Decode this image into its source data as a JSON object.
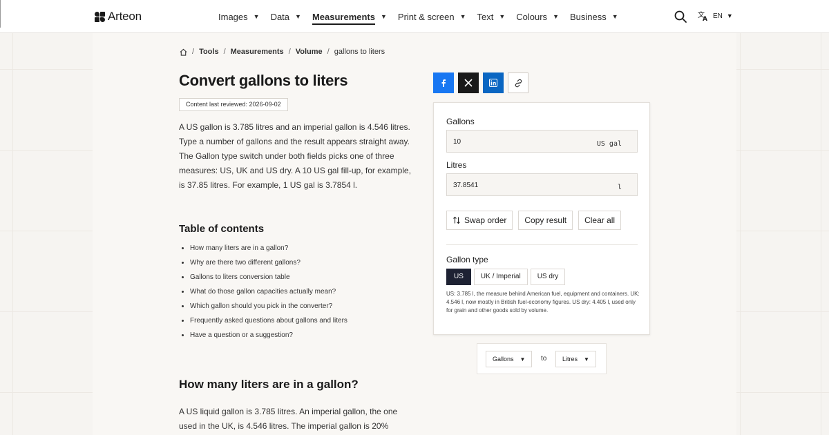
{
  "header": {
    "brand": "Arteon",
    "nav": [
      {
        "label": "Images",
        "active": false
      },
      {
        "label": "Data",
        "active": false
      },
      {
        "label": "Measurements",
        "active": true
      },
      {
        "label": "Print & screen",
        "active": false
      },
      {
        "label": "Text",
        "active": false
      },
      {
        "label": "Colours",
        "active": false
      },
      {
        "label": "Business",
        "active": false
      }
    ],
    "lang": "EN",
    "icons": {
      "search": "search-icon",
      "translate": "translate-icon",
      "caret": "chevron-down-icon"
    }
  },
  "breadcrumb": {
    "items": [
      "Tools",
      "Measurements",
      "Volume"
    ],
    "current": "gallons to liters"
  },
  "article": {
    "title": "Convert gallons to liters",
    "reviewed": "Content last reviewed: 2026-09-02",
    "intro": "A US gallon is 3.785 litres and an imperial gallon is 4.546 litres. Type a number of gallons and the result appears straight away. The Gallon type switch under both fields picks one of three measures: US, UK and US dry. A 10 US gal fill-up, for example, is 37.85 litres. For example, 1 US gal is 3.7854 l.",
    "toc_title": "Table of contents",
    "toc": [
      "How many liters are in a gallon?",
      "Why are there two different gallons?",
      "Gallons to liters conversion table",
      "What do those gallon capacities actually mean?",
      "Which gallon should you pick in the converter?",
      "Frequently asked questions about gallons and liters",
      "Have a question or a suggestion?"
    ],
    "section_title": "How many liters are in a gallon?",
    "section_para": "A US liquid gallon is 3.785 litres. An imperial gallon, the one used in the UK, is 4.546 litres. The imperial gallon is 20%"
  },
  "share": [
    "facebook-icon",
    "x-icon",
    "linkedin-icon",
    "link-icon"
  ],
  "converter": {
    "from_label": "Gallons",
    "from_value": "10",
    "from_unit": "US gal",
    "to_label": "Litres",
    "to_value": "37.8541",
    "to_unit": "l",
    "swap_label": "Swap order",
    "copy_label": "Copy result",
    "clear_label": "Clear all",
    "gallon_type_label": "Gallon type",
    "gallon_types": [
      {
        "label": "US",
        "active": true
      },
      {
        "label": "UK / Imperial",
        "active": false
      },
      {
        "label": "US dry",
        "active": false
      }
    ],
    "note": "US: 3.785 l, the measure behind American fuel, equipment and containers. UK: 4.546 l, now mostly in British fuel-economy figures. US dry: 4.405 l, used only for grain and other goods sold by volume."
  },
  "unit_picker": {
    "from": "Gallons",
    "to_word": "to",
    "to": "Litres"
  }
}
